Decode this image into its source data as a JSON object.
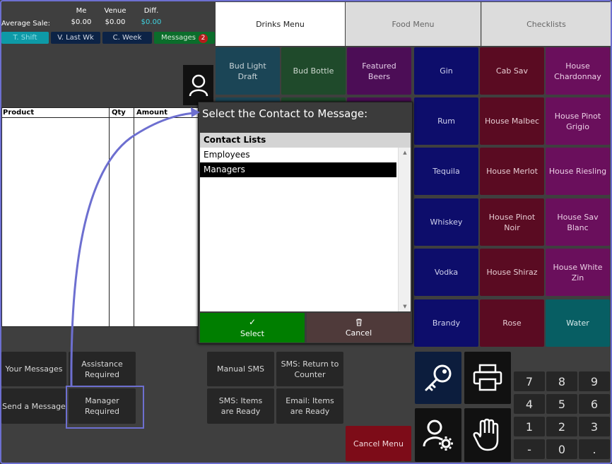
{
  "stats": {
    "label": "Average Sale:",
    "me": {
      "label": "Me",
      "value": "$0.00"
    },
    "venue": {
      "label": "Venue",
      "value": "$0.00"
    },
    "diff": {
      "label": "Diff.",
      "value": "$0.00"
    }
  },
  "period_buttons": [
    "T. Shift",
    "V. Last Wk",
    "C. Week"
  ],
  "messages": {
    "label": "Messages",
    "count": "2"
  },
  "tabs": [
    "Drinks Menu",
    "Food Menu",
    "Checklists"
  ],
  "menu_items": {
    "bud_light_draft": "Bud Light Draft",
    "bud_bottle": "Bud Bottle",
    "featured_beers": "Featured Beers",
    "gin": "Gin",
    "cab_sav": "Cab Sav",
    "house_chardonnay": "House Chardonnay",
    "rum": "Rum",
    "house_malbec": "House Malbec",
    "house_pinot_grigio": "House Pinot Grigio",
    "tequila": "Tequila",
    "house_merlot": "House Merlot",
    "house_riesling": "House Riesling",
    "whiskey": "Whiskey",
    "house_pinot_noir": "House Pinot Noir",
    "house_sav_blanc": "House Sav Blanc",
    "vodka": "Vodka",
    "house_shiraz": "House Shiraz",
    "house_white_zin": "House White Zin",
    "brandy": "Brandy",
    "rose": "Rose",
    "water": "Water"
  },
  "order_table": {
    "columns": [
      "Product",
      "Qty",
      "Amount"
    ]
  },
  "actions": {
    "your_messages": "Your Messages",
    "assistance_required": "Assistance Required",
    "send_message": "Send a Message",
    "manager_required": "Manager Required",
    "manual_sms": "Manual SMS",
    "sms_return": "SMS: Return to Counter",
    "sms_items_ready": "SMS: Items are Ready",
    "email_items_ready": "Email: Items are Ready",
    "cancel_menu": "Cancel Menu"
  },
  "keypad": [
    "7",
    "8",
    "9",
    "4",
    "5",
    "6",
    "1",
    "2",
    "3",
    "-",
    "0",
    "."
  ],
  "dialog": {
    "title": "Select the Contact to Message:",
    "list_header": "Contact Lists",
    "items": [
      "Employees",
      "Managers"
    ],
    "select_label": "Select",
    "cancel_label": "Cancel"
  },
  "colors": {
    "accent": "#6d6fd0",
    "select_green": "#007e00",
    "cancel_red": "#7d0c18",
    "message_green": "#0b6d2b",
    "shift_teal": "#0e9aa7"
  }
}
